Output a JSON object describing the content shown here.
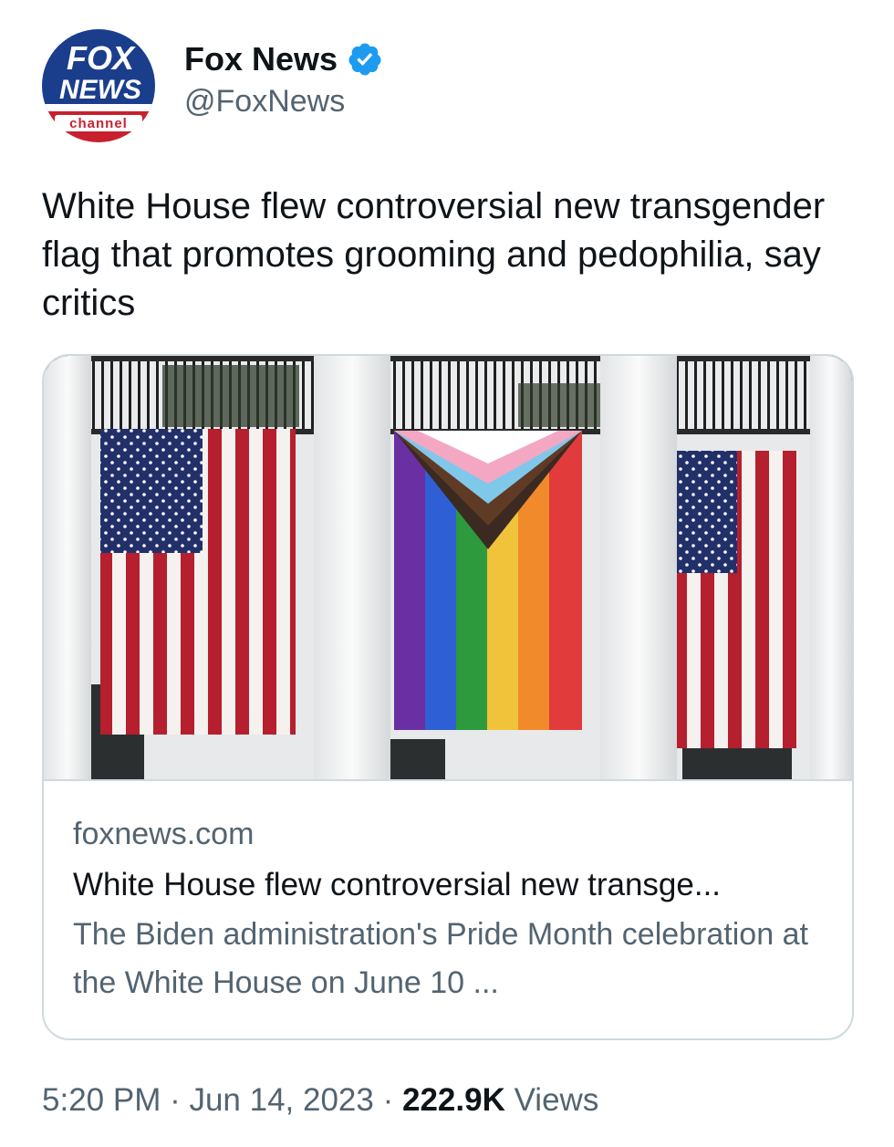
{
  "author": {
    "display_name": "Fox News",
    "handle": "@FoxNews",
    "avatar_text_top": "FOX",
    "avatar_text_middle": "NEWS",
    "avatar_text_bottom": "channel"
  },
  "tweet": {
    "text": "White House flew controversial new transgender flag that promotes grooming and pedophilia, say critics"
  },
  "card": {
    "domain": "foxnews.com",
    "title": "White House flew controversial new transge...",
    "description": "The Biden administration's Pride Month celebration at the White House on June 10 ..."
  },
  "meta": {
    "time": "5:20 PM",
    "separator1": " · ",
    "date": "Jun 14, 2023",
    "separator2": " · ",
    "views_count": "222.9K",
    "views_label": " Views"
  },
  "colors": {
    "verified_blue": "#1d9bf0",
    "secondary_text": "#536471",
    "primary_text": "#0f1419",
    "border": "#cfd9de",
    "fox_blue": "#1a3e8c",
    "fox_red": "#c8202f"
  }
}
